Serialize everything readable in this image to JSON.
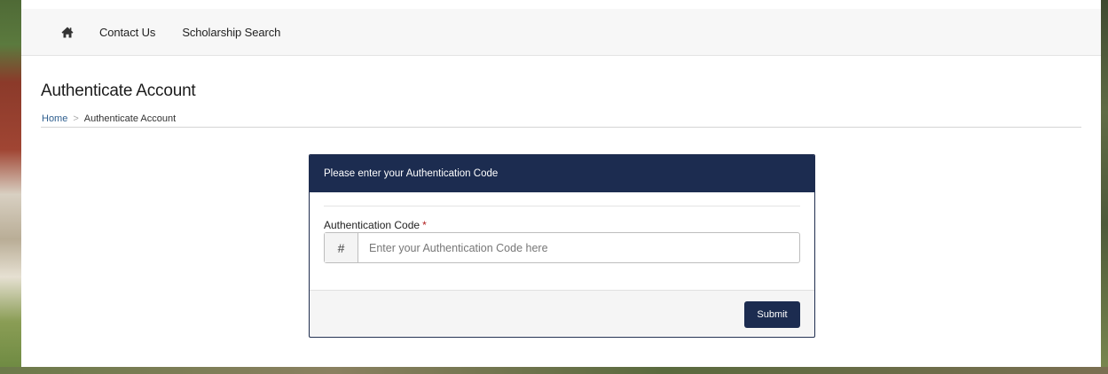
{
  "nav": {
    "home_icon": "home-icon",
    "links": [
      "Contact Us",
      "Scholarship Search"
    ]
  },
  "page": {
    "title": "Authenticate Account",
    "breadcrumb": {
      "home": "Home",
      "separator": ">",
      "current": "Authenticate Account"
    }
  },
  "card": {
    "header": "Please enter your Authentication Code",
    "field_label": "Authentication Code",
    "required_marker": "*",
    "addon": "#",
    "input_value": "",
    "input_placeholder": "Enter your Authentication Code here",
    "submit_label": "Submit"
  },
  "colors": {
    "primary": "#1c2c50",
    "link": "#2f5f8f",
    "required": "#b01c1c"
  }
}
